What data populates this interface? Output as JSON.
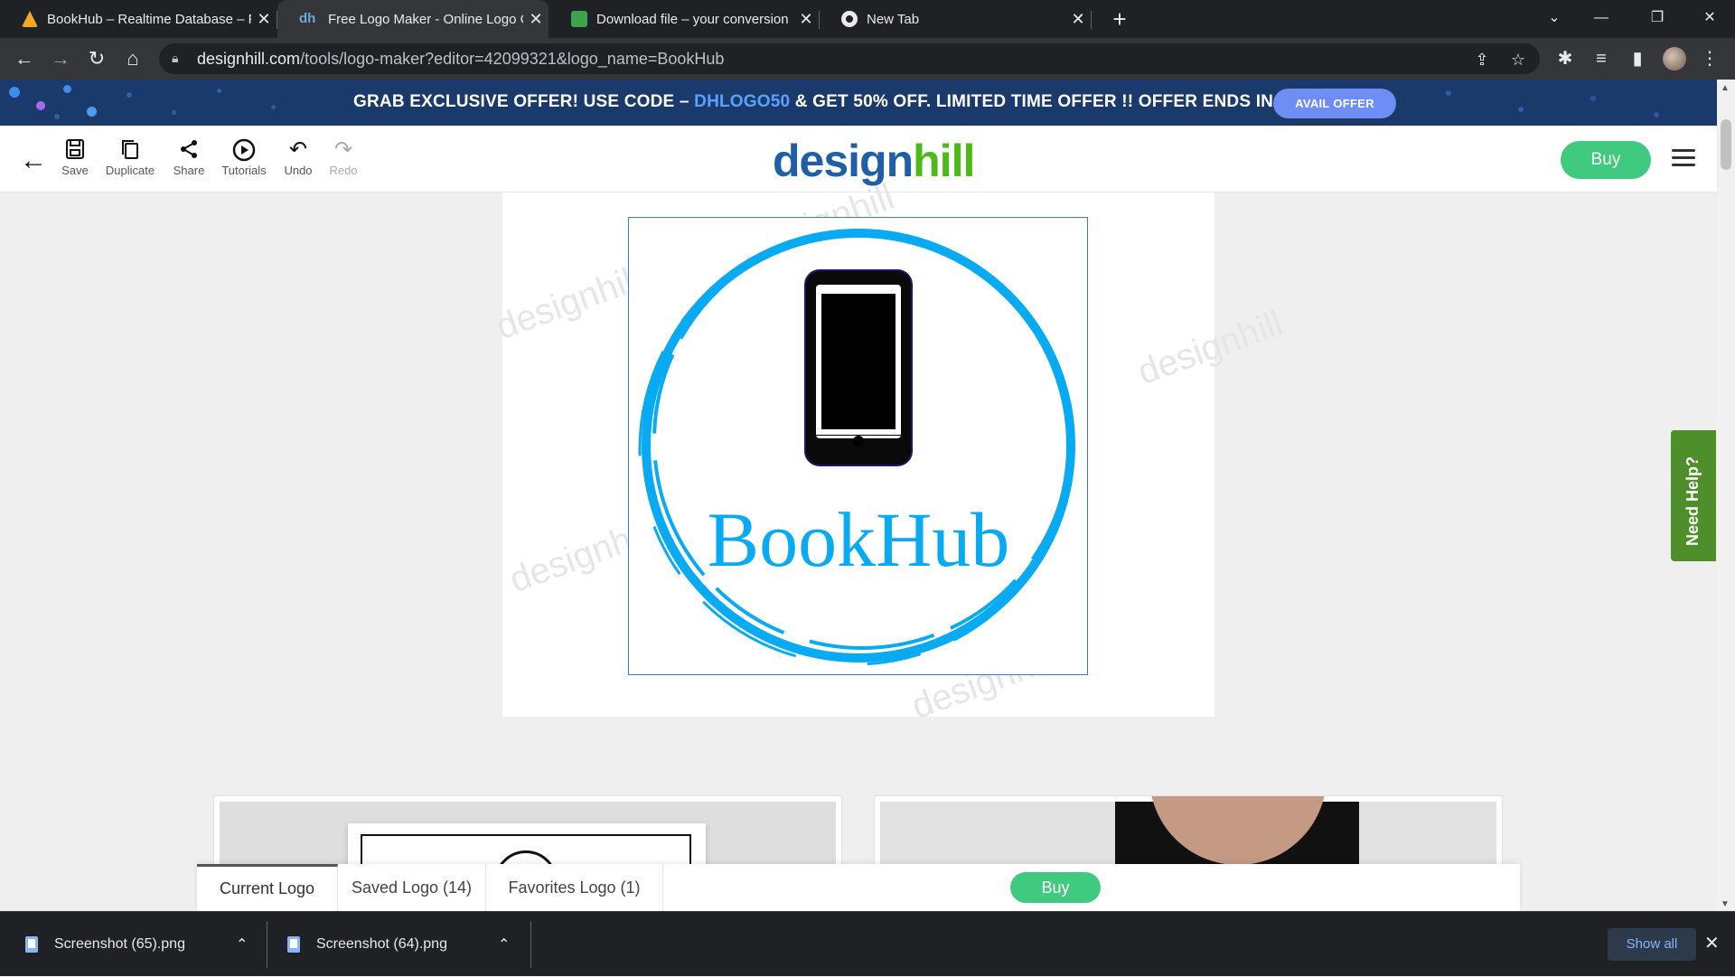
{
  "browser": {
    "tabs": [
      {
        "title": "BookHub – Realtime Database – F",
        "favicon": "firebase-icon",
        "color": "#f5a623"
      },
      {
        "title": "Free Logo Maker - Online Logo C",
        "favicon": "designhill-icon",
        "color": "#1f5fa8"
      },
      {
        "title": "Download file – your conversion",
        "favicon": "converter-icon",
        "color": "#3fa34d"
      },
      {
        "title": "New Tab",
        "favicon": "chrome-icon",
        "color": "#e8eaed"
      }
    ],
    "url_host": "designhill.com",
    "url_path": "/tools/logo-maker?editor=42099321&logo_name=BookHub"
  },
  "promo": {
    "prefix": "GRAB EXCLUSIVE OFFER! USE CODE – ",
    "code": "DHLOGO50",
    "suffix": " & GET 50% OFF. LIMITED TIME OFFER !! OFFER ENDS IN 07:46:09",
    "button": "AVAIL OFFER"
  },
  "toolbar": {
    "save": "Save",
    "duplicate": "Duplicate",
    "share": "Share",
    "tutorials": "Tutorials",
    "undo": "Undo",
    "redo": "Redo",
    "brand_design": "design",
    "brand_hill": "hill",
    "buy": "Buy"
  },
  "canvas": {
    "logo_text": "BookHub",
    "watermark": "designhill",
    "circle_color": "#08aaf2"
  },
  "need_help": "Need Help?",
  "bottom_tabs": {
    "current": "Current Logo",
    "saved": "Saved Logo (14)",
    "favorites": "Favorites Logo (1)",
    "buy": "Buy"
  },
  "downloads": {
    "items": [
      "Screenshot (65).png",
      "Screenshot (64).png"
    ],
    "show_all": "Show all"
  }
}
